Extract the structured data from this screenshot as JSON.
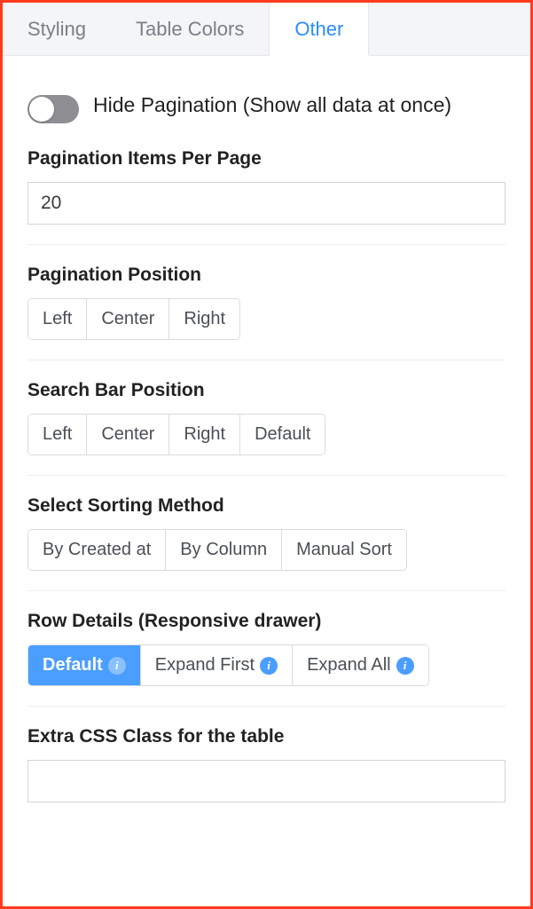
{
  "tabs": {
    "styling": "Styling",
    "table_colors": "Table Colors",
    "other": "Other"
  },
  "hide_pagination": {
    "label": "Hide Pagination (Show all data at once)",
    "value": false
  },
  "items_per_page": {
    "label": "Pagination Items Per Page",
    "value": "20"
  },
  "pagination_position": {
    "label": "Pagination Position",
    "options": {
      "left": "Left",
      "center": "Center",
      "right": "Right"
    }
  },
  "search_bar_position": {
    "label": "Search Bar Position",
    "options": {
      "left": "Left",
      "center": "Center",
      "right": "Right",
      "default": "Default"
    }
  },
  "sorting_method": {
    "label": "Select Sorting Method",
    "options": {
      "created": "By Created at",
      "column": "By Column",
      "manual": "Manual Sort"
    }
  },
  "row_details": {
    "label": "Row Details (Responsive drawer)",
    "options": {
      "default": "Default",
      "expand_first": "Expand First",
      "expand_all": "Expand All"
    },
    "selected": "default"
  },
  "extra_css": {
    "label": "Extra CSS Class for the table",
    "value": ""
  },
  "info_glyph": "i"
}
